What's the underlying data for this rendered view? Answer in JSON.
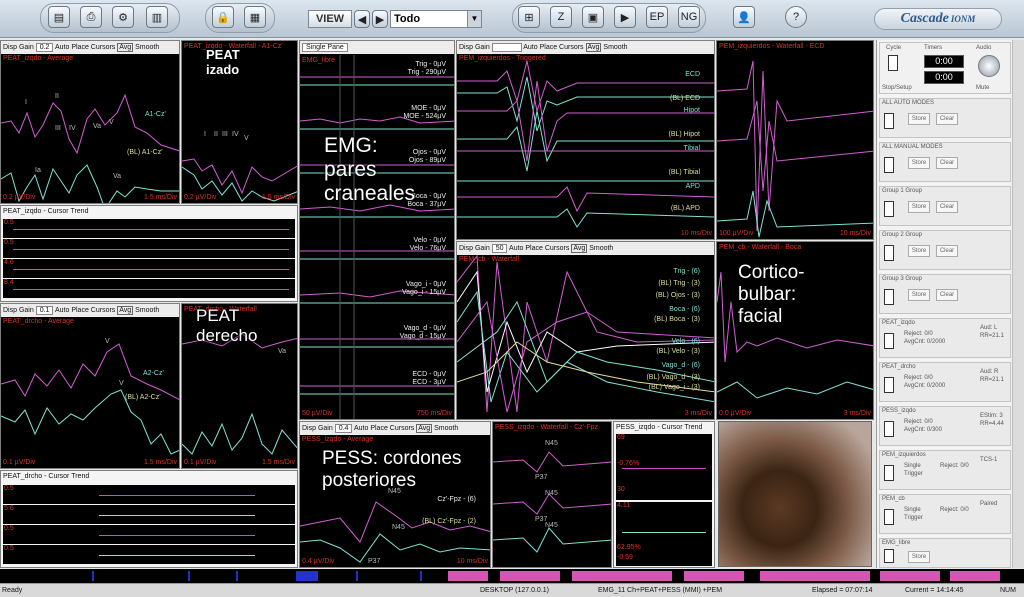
{
  "toolbar": {
    "view_label": "VIEW",
    "view_value": "Todo",
    "logo": "Cascade",
    "logo_sub": "IONM"
  },
  "panels": {
    "peat_izdo_avg": {
      "hdr_gain": "Disp Gain",
      "gain": "0.2",
      "auto": "Auto Place Cursors",
      "avg": "Avg",
      "smooth": "Smooth",
      "title": "PEAT_izqdo - Average",
      "labels": [
        "A1-Cz'",
        "(BL) A1-Cz'"
      ],
      "peaks": [
        "I",
        "II",
        "III",
        "IV",
        "V",
        "Va",
        "Ia",
        "Va"
      ],
      "scale_l": "0.2 µV/Div",
      "scale_r": "1.5 ms/Div"
    },
    "peat_izdo_wf": {
      "title": "PEAT_izqdo - Waterfall - A1-Cz'",
      "scale_l": "0.2 µV/Div",
      "scale_r": "1.5 ms/Div",
      "peaks": [
        "I",
        "II",
        "III",
        "IV",
        "V"
      ]
    },
    "peat_izdo_trend": {
      "title": "PEAT_izqdo - Cursor Trend",
      "rows": [
        "0.5",
        "0.5",
        "4.6",
        "8.4"
      ]
    },
    "emg": {
      "mode": "Single Pane",
      "title": "EMG_libre",
      "channels": [
        {
          "a": "Trig - 0µV",
          "b": "Trig - 290µV"
        },
        {
          "a": "MOE - 0µV",
          "b": "MOE - 524µV"
        },
        {
          "a": "Ojos - 0µV",
          "b": "Ojos - 89µV"
        },
        {
          "a": "Boca - 0µV",
          "b": "Boca - 37µV"
        },
        {
          "a": "Velo - 0µV",
          "b": "Velo - 76µV"
        },
        {
          "a": "Vago_i - 0µV",
          "b": "Vago_i - 15µV"
        },
        {
          "a": "Vago_d - 0µV",
          "b": "Vago_d - 15µV"
        },
        {
          "a": "ECD - 0µV",
          "b": "ECD - 3µV"
        }
      ],
      "scale_l": "50 µV/Div",
      "scale_r": "750 ms/Div"
    },
    "pem_trig": {
      "hdr_gain": "Disp Gain",
      "auto": "Auto Place Cursors",
      "avg": "Avg",
      "smooth": "Smooth",
      "title": "PEM_izquierdos - Triggered",
      "labels": [
        "ECD",
        "(BL) ECD",
        "Hipot",
        "(BL) Hipot",
        "Tibial",
        "(BL) Tibial",
        "APD",
        "(BL) APD"
      ],
      "scale_r": "10 ms/Div"
    },
    "pem_wf_ecd": {
      "title": "PEM_izquierdos - Waterfall - ECD",
      "scale_l": "100 µV/Div",
      "scale_r": "10 ms/Div"
    },
    "peat_dcho_avg": {
      "hdr_gain": "Disp Gain",
      "gain": "0.1",
      "auto": "Auto Place Cursors",
      "avg": "Avg",
      "smooth": "Smooth",
      "title": "PEAT_drcho - Average",
      "labels": [
        "A2-Cz'",
        "(BL) A2-Cz'"
      ],
      "peaks": [
        "V",
        "V"
      ],
      "scale_l": "0.1 µV/Div",
      "scale_r": "1.5 ms/Div"
    },
    "peat_dcho_wf": {
      "title": "PEAT_drcho - Waterfall",
      "scale_l": "0.1 µV/Div",
      "scale_r": "1.5 ms/Div",
      "peaks": [
        "Va"
      ]
    },
    "peat_dcho_trend": {
      "title": "PEAT_drcho - Cursor Trend",
      "rows": [
        "0.5",
        "5.6",
        "0.5",
        "0.5"
      ]
    },
    "cortico": {
      "hdr_gain": "Disp Gain",
      "gain": "50",
      "auto": "Auto Place Cursors",
      "avg": "Avg",
      "smooth": "Smooth",
      "title": "PEM_cb - Waterfall",
      "labels": [
        "Trig - (6)",
        "(BL) Trig - (3)",
        "(BL) Ojos - (3)",
        "Boca - (6)",
        "(BL) Boca - (3)",
        "Velo - (6)",
        "(BL) Velo - (3)",
        "Vago_d - (6)",
        "(BL) Vago_d - (3)",
        "(BL) Vago_i - (3)"
      ],
      "scale_r": "3 ms/Div"
    },
    "pem_wf_boca": {
      "title": "PEM_cb - Waterfall - Boca",
      "scale_l": "0.0 µV/Div",
      "scale_r": "3 ms/Div"
    },
    "pess_avg": {
      "hdr_gain": "Disp Gain",
      "gain": "0.4",
      "auto": "Auto Place Cursors",
      "avg": "Avg",
      "smooth": "Smooth",
      "title": "PESS_izqdo - Average",
      "labels": [
        "Cz'-Fpz - (6)",
        "(BL) Cz'-Fpz - (2)"
      ],
      "peaks": [
        "N45",
        "N45",
        "P37"
      ],
      "scale_l": "0.4 µV/Div",
      "scale_r": "10 ms/Div"
    },
    "pess_wf": {
      "title": "PESS_izqdo - Waterfall - Cz'-Fpz",
      "peaks": [
        "N45",
        "P37",
        "N45",
        "P37",
        "N45"
      ]
    },
    "pess_trend": {
      "title": "PESS_izqdo - Cursor Trend",
      "vals": [
        "69",
        "-0.76%",
        "30",
        "4.11",
        "62.95%",
        "-0.59"
      ]
    }
  },
  "overlays": {
    "peat_izdo": "PEAT\nizado",
    "emg": "EMG:\npares\ncraneales",
    "peat_dcho": "PEAT\nderecho",
    "pess": "PESS: cordones\nposteriores",
    "cortico": "Cortico-\nbulbar:\nfacial"
  },
  "sidebar": {
    "cycle": "Cycle",
    "timers": "Timers",
    "audio": "Audio",
    "t1": "0:00",
    "t2": "0:00",
    "stopsetup": "Stop/Setup",
    "mute": "Mute",
    "modes": [
      {
        "title": "ALL AUTO MODES",
        "store": "Store",
        "clear": "Clear"
      },
      {
        "title": "ALL MANUAL MODES",
        "store": "Store",
        "clear": "Clear"
      },
      {
        "title": "Group 1 Group",
        "store": "Store",
        "clear": "Clear"
      },
      {
        "title": "Group 2 Group",
        "store": "Store",
        "clear": "Clear"
      },
      {
        "title": "Group 3 Group",
        "store": "Store",
        "clear": "Clear"
      }
    ],
    "groups": [
      {
        "title": "PEAT_izqdo",
        "a": "Reject: 0/0",
        "b": "AvgCnt: 0/2000",
        "c": "Aud: L",
        "d": "RR=21.1"
      },
      {
        "title": "PEAT_drcho",
        "a": "Reject: 0/0",
        "b": "AvgCnt: 0/2000",
        "c": "Aud: R",
        "d": "RR=21.1"
      },
      {
        "title": "PESS_izqdo",
        "a": "Reject: 0/0",
        "b": "AvgCnt: 0/300",
        "c": "EStim: 3",
        "d": "RR=4.44"
      },
      {
        "title": "PEM_izquierdos",
        "a": "Single",
        "b": "Trigger",
        "c": "Reject: 0/0",
        "d": "TCS-1"
      },
      {
        "title": "PEM_cb",
        "a": "Single",
        "b": "Trigger",
        "c": "Reject: 0/0",
        "d": "Paired"
      },
      {
        "title": "EMG_libre",
        "a": "Store",
        "b": "",
        "c": "",
        "d": ""
      }
    ]
  },
  "status": {
    "ready": "Ready",
    "host": "DESKTOP (127.0.0.1)",
    "session": "EMG_11 Ch+PEAT+PESS (MMI) +PEM",
    "elapsed": "Elapsed = 07:07:14",
    "current": "Current = 14:14:45",
    "num": "NUM"
  }
}
